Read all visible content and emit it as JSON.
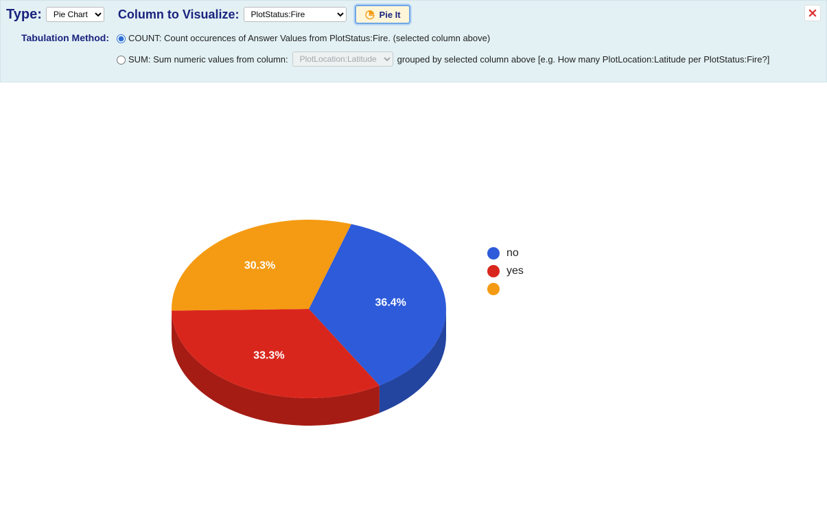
{
  "controls": {
    "type_label": "Type:",
    "type_value": "Pie Chart",
    "column_label": "Column to Visualize:",
    "column_value": "PlotStatus:Fire",
    "pie_button": "Pie It",
    "tab_method_label": "Tabulation Method:",
    "count_label": "COUNT: Count occurences of Answer Values from PlotStatus:Fire. (selected column above)",
    "sum_label_pre": "SUM: Sum numeric values from column:",
    "sum_select_value": "PlotLocation:Latitude",
    "sum_label_post": "grouped by selected column above [e.g. How many PlotLocation:Latitude per PlotStatus:Fire?]"
  },
  "chart_data": {
    "type": "pie",
    "title": "",
    "series": [
      {
        "name": "no",
        "value": 36.4,
        "label": "36.4%",
        "color": "#2e5bd9",
        "side_color": "#23449f"
      },
      {
        "name": "yes",
        "value": 33.3,
        "label": "33.3%",
        "color": "#d9261c",
        "side_color": "#a51c14"
      },
      {
        "name": "",
        "value": 30.3,
        "label": "30.3%",
        "color": "#f49b13",
        "side_color": "#c07708"
      }
    ],
    "legend_position": "right"
  }
}
